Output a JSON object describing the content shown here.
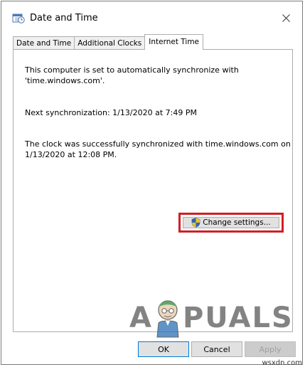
{
  "window": {
    "title": "Date and Time"
  },
  "tabs": [
    {
      "label": "Date and Time"
    },
    {
      "label": "Additional Clocks"
    },
    {
      "label": "Internet Time"
    }
  ],
  "panel": {
    "sync_line1": "This computer is set to automatically synchronize with",
    "sync_line2": "'time.windows.com'.",
    "next_sync": "Next synchronization: 1/13/2020 at 7:49 PM",
    "success_line1": "The clock was successfully synchronized with time.windows.com on",
    "success_line2": "1/13/2020 at 12:08 PM.",
    "change_settings_label": "Change settings..."
  },
  "footer": {
    "ok_label": "OK",
    "cancel_label": "Cancel",
    "apply_label": "Apply"
  },
  "watermark": {
    "left": "A",
    "right": "PUALS"
  },
  "source_label": "wsxdn.com",
  "colors": {
    "highlight_border": "#d01f24",
    "focus_border": "#0078d7"
  }
}
